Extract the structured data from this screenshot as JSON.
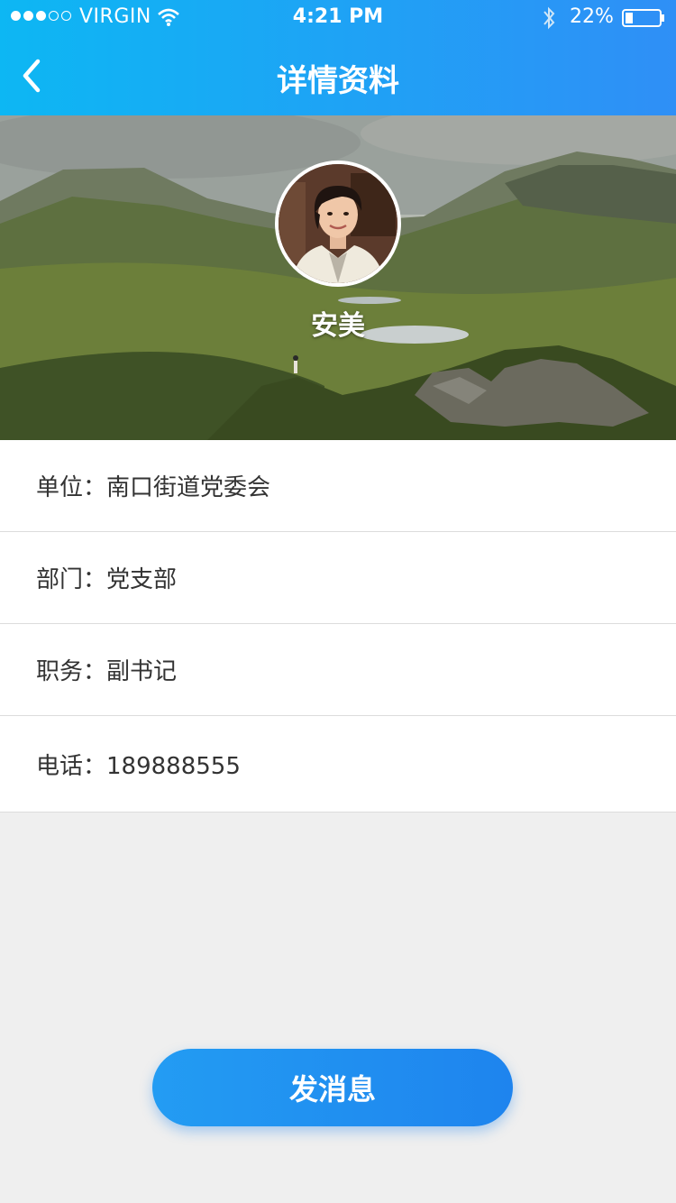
{
  "status_bar": {
    "carrier": "VIRGIN",
    "time": "4:21 PM",
    "battery": "22%",
    "signal_icon": "signal-dots-icon",
    "wifi_icon": "wifi-icon",
    "bluetooth_icon": "bluetooth-icon",
    "battery_icon": "battery-icon"
  },
  "nav": {
    "back_icon": "chevron-left-icon",
    "title": "详情资料"
  },
  "profile": {
    "name": "安美"
  },
  "info": [
    {
      "label": "单位：南口街道党委会"
    },
    {
      "label": "部门：党支部"
    },
    {
      "label": "职务：副书记"
    },
    {
      "label": "电话：189888555"
    }
  ],
  "actions": {
    "send_message": "发消息"
  },
  "colors": {
    "header_start": "#0db7f3",
    "header_end": "#2f8ff6",
    "button": "#1e84ee",
    "background": "#efefef"
  }
}
